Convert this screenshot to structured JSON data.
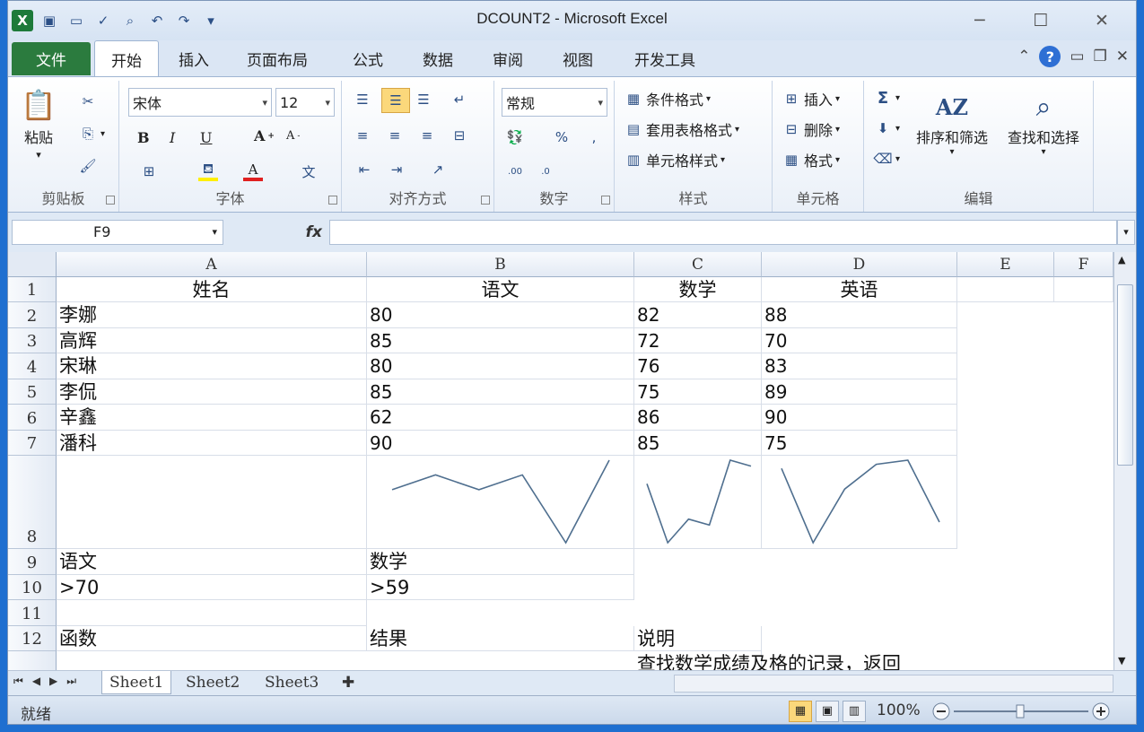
{
  "window": {
    "title": "DCOUNT2  -  Microsoft Excel",
    "controls": [
      "─",
      "☐",
      "✕"
    ]
  },
  "qat": [
    "excel-icon",
    "save-icon",
    "new-icon",
    "spellcheck-icon",
    "print-preview-icon",
    "undo-icon",
    "redo-icon",
    "customize-icon"
  ],
  "tabs": [
    {
      "label": "文件",
      "file": true
    },
    {
      "label": "开始",
      "active": true
    },
    {
      "label": "插入"
    },
    {
      "label": "页面布局"
    },
    {
      "label": "公式"
    },
    {
      "label": "数据"
    },
    {
      "label": "审阅"
    },
    {
      "label": "视图"
    },
    {
      "label": "开发工具"
    }
  ],
  "ribbon": {
    "clipboard": {
      "label": "剪贴板",
      "paste": "粘贴"
    },
    "font": {
      "label": "字体",
      "name": "宋体",
      "size": "12",
      "bold": "B",
      "italic": "I",
      "underline": "U"
    },
    "alignment": {
      "label": "对齐方式"
    },
    "number": {
      "label": "数字",
      "format": "常规"
    },
    "styles": {
      "label": "样式",
      "cond": "条件格式",
      "table": "套用表格格式",
      "cell": "单元格样式"
    },
    "cells": {
      "label": "单元格",
      "insert": "插入",
      "delete": "删除",
      "format": "格式"
    },
    "editing": {
      "label": "编辑",
      "sort": "排序和筛选",
      "find": "查找和选择"
    }
  },
  "formula_bar": {
    "name_box": "F9",
    "fx": "fx",
    "content": ""
  },
  "columns": [
    "A",
    "B",
    "C",
    "D",
    "E",
    "F"
  ],
  "rows": [
    "1",
    "2",
    "3",
    "4",
    "5",
    "6",
    "7",
    "8",
    "9",
    "10",
    "11",
    "12"
  ],
  "cells": {
    "r1": [
      "姓名",
      "语文",
      "数学",
      "英语"
    ],
    "r2": [
      "李娜",
      "80",
      "82",
      "88"
    ],
    "r3": [
      "高辉",
      "85",
      "72",
      "70"
    ],
    "r4": [
      "宋琳",
      "80",
      "76",
      "83"
    ],
    "r5": [
      "李侃",
      "85",
      "75",
      "89"
    ],
    "r6": [
      "辛鑫",
      "62",
      "86",
      "90"
    ],
    "r7": [
      "潘科",
      "90",
      "85",
      "75"
    ],
    "r9": [
      "语文",
      "数学"
    ],
    "r10": [
      ">70",
      ">59"
    ],
    "r12": [
      "函数",
      "结果",
      "说明"
    ],
    "r13c": "查找数学成绩及格的记录，返回"
  },
  "sparklines": {
    "chinese": [
      80,
      85,
      80,
      85,
      62,
      90
    ],
    "math": [
      82,
      72,
      76,
      75,
      86,
      85
    ],
    "english": [
      88,
      70,
      83,
      89,
      90,
      75
    ],
    "color": "#4f6f8f"
  },
  "sheets": [
    "Sheet1",
    "Sheet2",
    "Sheet3"
  ],
  "status": {
    "ready": "就绪",
    "zoom": "100%"
  }
}
